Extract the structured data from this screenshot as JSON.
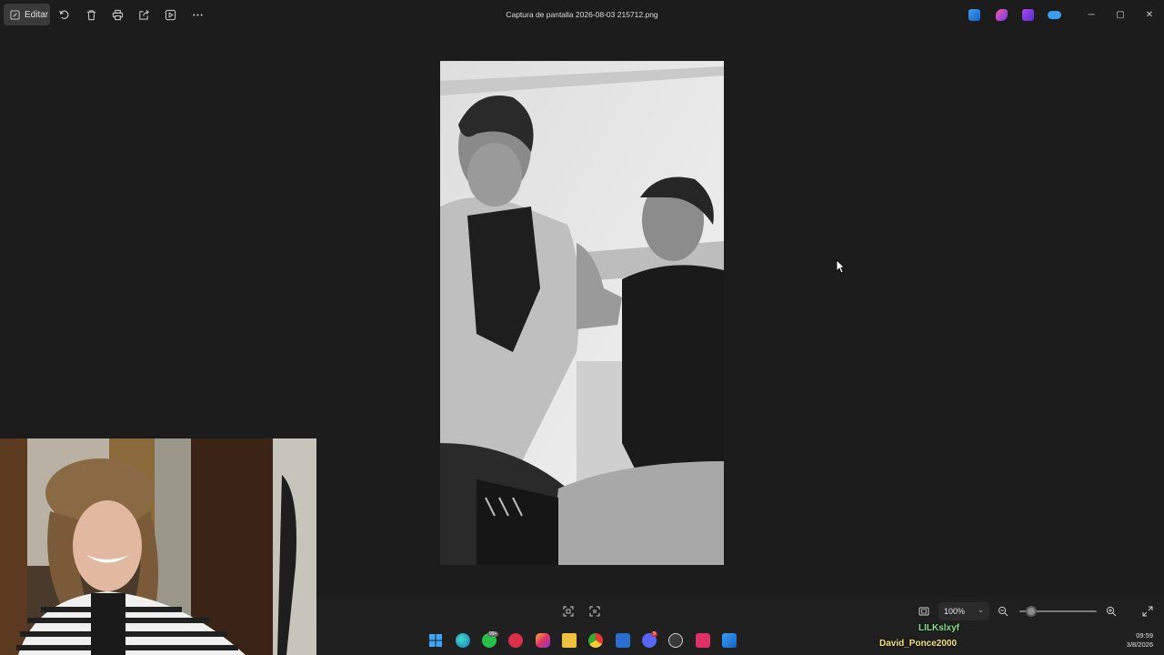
{
  "toolbar": {
    "edit_label": "Editar",
    "icons": [
      "rotate-icon",
      "delete-icon",
      "print-icon",
      "share-icon",
      "slideshow-icon",
      "more-icon"
    ],
    "app_icons": [
      "photos-icon",
      "clipchamp-icon",
      "video-editor-icon",
      "onedrive-icon"
    ]
  },
  "window": {
    "title": "Captura de pantalla 2026-08-03 215712.png",
    "minimize": "─",
    "maximize": "▢",
    "close": "✕"
  },
  "viewer": {
    "zoom_label": "100%",
    "zoom_level": 0.15
  },
  "taskbar": {
    "badge_whatsapp": "99+",
    "badge_discord": "9"
  },
  "chat": {
    "user1": "LILKslxyf",
    "user2": "David_Ponce2000"
  },
  "clock": {
    "time": "09:59",
    "date": "3/8/2026"
  },
  "colors": {
    "background": "#1c1c1c",
    "taskbar": "#202020",
    "accent": "#0078d4"
  }
}
